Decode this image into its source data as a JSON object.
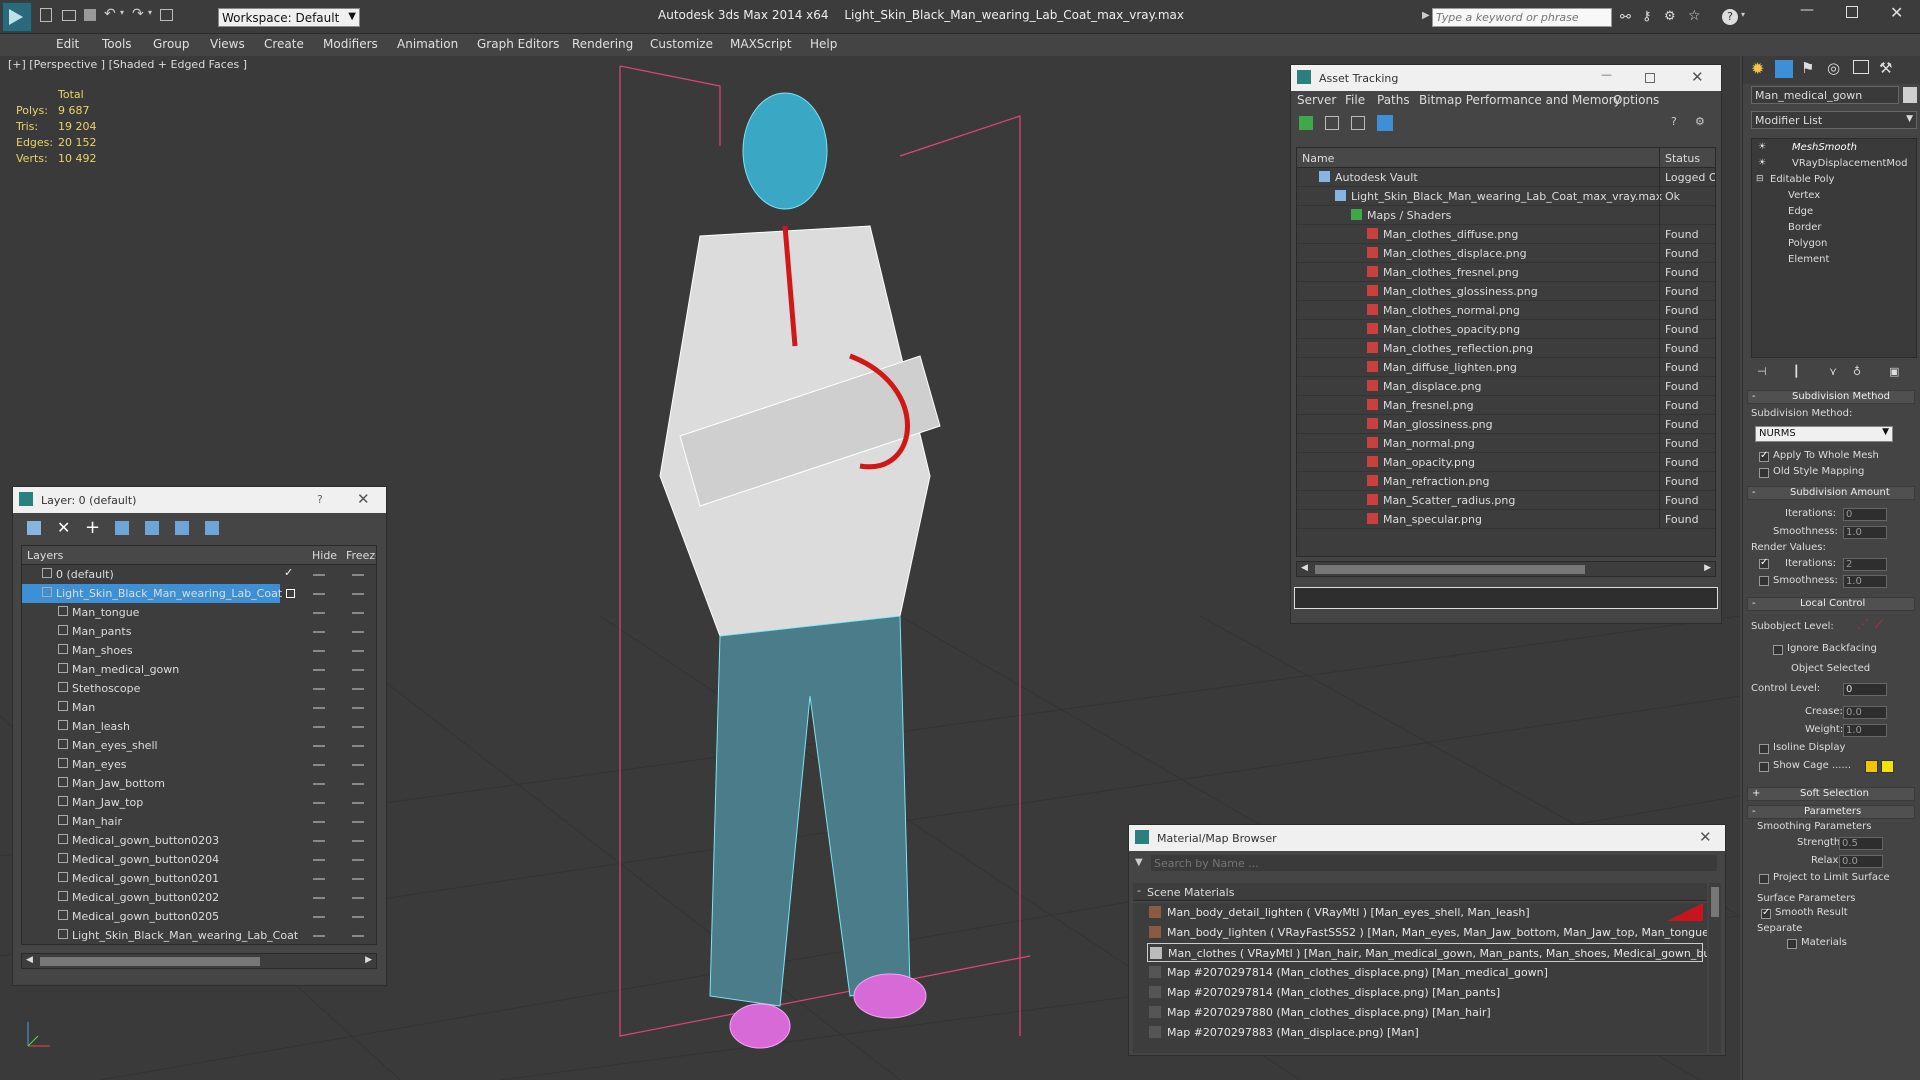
{
  "app": {
    "title": "Autodesk 3ds Max  2014 x64",
    "file": "Light_Skin_Black_Man_wearing_Lab_Coat_max_vray.max",
    "workspace": "Workspace: Default",
    "search_placeholder": "Type a keyword or phrase"
  },
  "menu": [
    "Edit",
    "Tools",
    "Group",
    "Views",
    "Create",
    "Modifiers",
    "Animation",
    "Graph Editors",
    "Rendering",
    "Customize",
    "MAXScript",
    "Help"
  ],
  "viewport": {
    "label": "[+] [Perspective ] [Shaded + Edged Faces ]",
    "stats": {
      "total_label": "Total",
      "rows": [
        {
          "k": "Polys:",
          "v": "9 687"
        },
        {
          "k": "Tris:",
          "v": "19 204"
        },
        {
          "k": "Edges:",
          "v": "20 152"
        },
        {
          "k": "Verts:",
          "v": "10 492"
        }
      ]
    }
  },
  "layers": {
    "title": "Layer: 0 (default)",
    "help": "?",
    "col_layers": "Layers",
    "col_hide": "Hide",
    "col_freeze": "Freeze",
    "rows": [
      {
        "name": "0 (default)",
        "level": 0
      },
      {
        "name": "Light_Skin_Black_Man_wearing_Lab_Coat",
        "level": 0
      },
      {
        "name": "Man_tongue",
        "level": 1
      },
      {
        "name": "Man_pants",
        "level": 1
      },
      {
        "name": "Man_shoes",
        "level": 1
      },
      {
        "name": "Man_medical_gown",
        "level": 1
      },
      {
        "name": "Stethoscope",
        "level": 1
      },
      {
        "name": "Man",
        "level": 1
      },
      {
        "name": "Man_leash",
        "level": 1
      },
      {
        "name": "Man_eyes_shell",
        "level": 1
      },
      {
        "name": "Man_eyes",
        "level": 1
      },
      {
        "name": "Man_Jaw_bottom",
        "level": 1
      },
      {
        "name": "Man_Jaw_top",
        "level": 1
      },
      {
        "name": "Man_hair",
        "level": 1
      },
      {
        "name": "Medical_gown_button0203",
        "level": 1
      },
      {
        "name": "Medical_gown_button0204",
        "level": 1
      },
      {
        "name": "Medical_gown_button0201",
        "level": 1
      },
      {
        "name": "Medical_gown_button0202",
        "level": 1
      },
      {
        "name": "Medical_gown_button0205",
        "level": 1
      },
      {
        "name": "Light_Skin_Black_Man_wearing_Lab_Coat",
        "level": 1
      }
    ]
  },
  "asset": {
    "title": "Asset Tracking",
    "menu": [
      "Server",
      "File",
      "Paths",
      "Bitmap Performance and Memory",
      "Options"
    ],
    "col_name": "Name",
    "col_status": "Status",
    "rows": [
      {
        "name": "Autodesk Vault",
        "status": "Logged O",
        "level": 1
      },
      {
        "name": "Light_Skin_Black_Man_wearing_Lab_Coat_max_vray.max",
        "status": "Ok",
        "level": 2
      },
      {
        "name": "Maps / Shaders",
        "status": "",
        "level": 3
      },
      {
        "name": "Man_clothes_diffuse.png",
        "status": "Found",
        "level": 4
      },
      {
        "name": "Man_clothes_displace.png",
        "status": "Found",
        "level": 4
      },
      {
        "name": "Man_clothes_fresnel.png",
        "status": "Found",
        "level": 4
      },
      {
        "name": "Man_clothes_glossiness.png",
        "status": "Found",
        "level": 4
      },
      {
        "name": "Man_clothes_normal.png",
        "status": "Found",
        "level": 4
      },
      {
        "name": "Man_clothes_opacity.png",
        "status": "Found",
        "level": 4
      },
      {
        "name": "Man_clothes_reflection.png",
        "status": "Found",
        "level": 4
      },
      {
        "name": "Man_diffuse_lighten.png",
        "status": "Found",
        "level": 4
      },
      {
        "name": "Man_displace.png",
        "status": "Found",
        "level": 4
      },
      {
        "name": "Man_fresnel.png",
        "status": "Found",
        "level": 4
      },
      {
        "name": "Man_glossiness.png",
        "status": "Found",
        "level": 4
      },
      {
        "name": "Man_normal.png",
        "status": "Found",
        "level": 4
      },
      {
        "name": "Man_opacity.png",
        "status": "Found",
        "level": 4
      },
      {
        "name": "Man_refraction.png",
        "status": "Found",
        "level": 4
      },
      {
        "name": "Man_Scatter_radius.png",
        "status": "Found",
        "level": 4
      },
      {
        "name": "Man_specular.png",
        "status": "Found",
        "level": 4
      }
    ]
  },
  "matbrowser": {
    "title": "Material/Map Browser",
    "search_placeholder": "Search by Name ...",
    "group": "Scene Materials",
    "rows": [
      "Man_body_detail_lighten ( VRayMtl ) [Man_eyes_shell, Man_leash]",
      "Man_body_lighten ( VRayFastSSS2 ) [Man, Man_eyes, Man_Jaw_bottom, Man_Jaw_top, Man_tongue]",
      "Man_clothes ( VRayMtl ) [Man_hair, Man_medical_gown, Man_pants, Man_shoes, Medical_gown_butto...",
      "Map #2070297814 (Man_clothes_displace.png) [Man_medical_gown]",
      "Map #2070297814 (Man_clothes_displace.png) [Man_pants]",
      "Map #2070297880 (Man_clothes_displace.png) [Man_hair]",
      "Map #2070297883 (Man_displace.png) [Man]"
    ]
  },
  "cmd": {
    "object_name": "Man_medical_gown",
    "modifier_list": "Modifier List",
    "stack": [
      "MeshSmooth",
      "VRayDisplacementMod",
      "Editable Poly",
      "Vertex",
      "Edge",
      "Border",
      "Polygon",
      "Element"
    ],
    "subdiv_method_head": "Subdivision Method",
    "subdiv_method_label": "Subdivision Method:",
    "subdiv_method_value": "NURMS",
    "apply_whole": "Apply To Whole Mesh",
    "old_style": "Old Style Mapping",
    "subdiv_amount_head": "Subdivision Amount",
    "iterations": "Iterations:",
    "iterations_val": "0",
    "smoothness": "Smoothness:",
    "smoothness_val": "1.0",
    "render_values": "Render Values:",
    "r_iterations_val": "2",
    "r_smoothness_val": "1.0",
    "local_control_head": "Local Control",
    "subobject_level": "Subobject Level:",
    "ignore_backfacing": "Ignore Backfacing",
    "object_selected": "Object Selected",
    "control_level": "Control Level:",
    "control_level_val": "0",
    "crease": "Crease:",
    "crease_val": "0.0",
    "weight": "Weight:",
    "weight_val": "1.0",
    "isoline": "Isoline Display",
    "show_cage": "Show Cage ......",
    "soft_selection_head": "Soft Selection",
    "parameters_head": "Parameters",
    "smoothing_params": "Smoothing Parameters",
    "strength": "Strength:",
    "strength_val": "0.5",
    "relax": "Relax:",
    "relax_val": "0.0",
    "project_limit": "Project to Limit Surface",
    "surface_params": "Surface Parameters",
    "smooth_result": "Smooth Result",
    "separate": "Separate",
    "materials": "Materials"
  },
  "colors": {
    "accent": "#3d8fd6",
    "cage1": "#f5c400",
    "cage2": "#f2e200"
  }
}
